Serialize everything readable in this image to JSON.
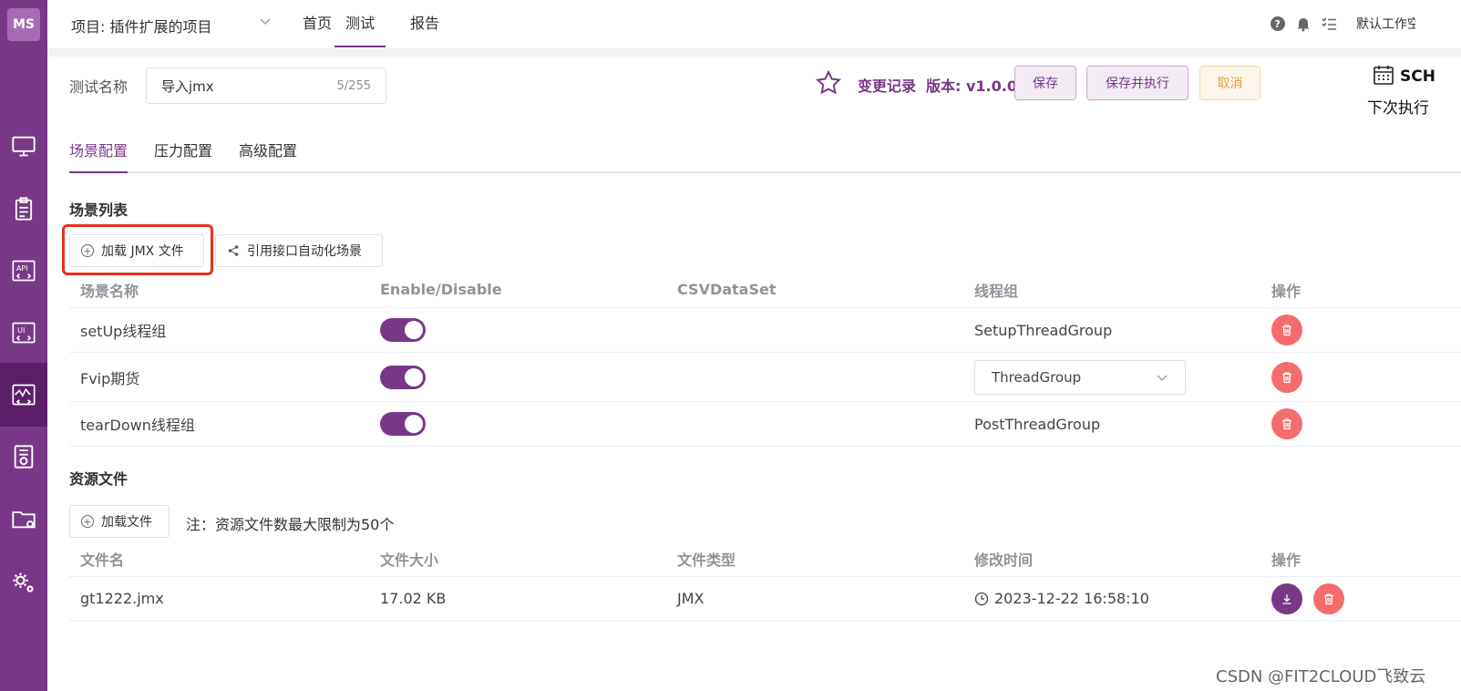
{
  "topbar": {
    "project": "项目: 插件扩展的项目",
    "nav": [
      "首页",
      "测试",
      "报告"
    ],
    "workspace": "默认工作空间"
  },
  "header": {
    "name_label": "测试名称",
    "name_value": "导入jmx",
    "name_count": "5/255",
    "change_log": "变更记录",
    "version": "版本: v1.0.0",
    "save": "保存",
    "save_run": "保存并执行",
    "cancel": "取消",
    "schedule": "SCH",
    "next_run": "下次执行"
  },
  "tabs": [
    "场景配置",
    "压力配置",
    "高级配置"
  ],
  "scenes": {
    "title": "场景列表",
    "load_jmx": "加载 JMX 文件",
    "ref_scene": "引用接口自动化场景",
    "columns": [
      "场景名称",
      "Enable/Disable",
      "CSVDataSet",
      "线程组",
      "操作"
    ],
    "rows": [
      {
        "name": "setUp线程组",
        "enabled": true,
        "csv": "",
        "thread_group": "SetupThreadGroup",
        "select": false
      },
      {
        "name": "Fvip期货",
        "enabled": true,
        "csv": "",
        "thread_group": "ThreadGroup",
        "select": true
      },
      {
        "name": "tearDown线程组",
        "enabled": true,
        "csv": "",
        "thread_group": "PostThreadGroup",
        "select": false
      }
    ]
  },
  "resources": {
    "title": "资源文件",
    "load_file": "加载文件",
    "note": "注：资源文件数最大限制为50个",
    "columns": [
      "文件名",
      "文件大小",
      "文件类型",
      "修改时间",
      "操作"
    ],
    "rows": [
      {
        "name": "gt1222.jmx",
        "size": "17.02 KB",
        "type": "JMX",
        "modified": "2023-12-22 16:58:10"
      }
    ]
  },
  "watermark": "CSDN @FIT2CLOUD飞致云",
  "colors": {
    "primary": "#783887",
    "danger": "#f56c6c",
    "warning": "#e6a23c",
    "highlight": "#e5301a"
  }
}
